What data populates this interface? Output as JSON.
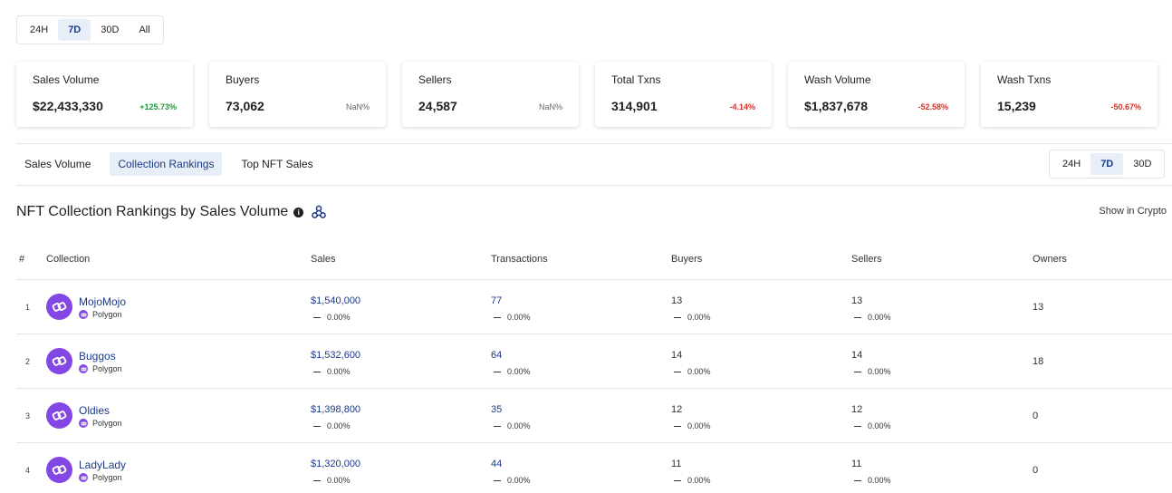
{
  "period_top": [
    "24H",
    "7D",
    "30D",
    "All"
  ],
  "period_top_active": 1,
  "stats": [
    {
      "label": "Sales Volume",
      "value": "$22,433,330",
      "change": "+125.73%",
      "trend": "pos"
    },
    {
      "label": "Buyers",
      "value": "73,062",
      "change": "NaN%",
      "trend": "neu"
    },
    {
      "label": "Sellers",
      "value": "24,587",
      "change": "NaN%",
      "trend": "neu"
    },
    {
      "label": "Total Txns",
      "value": "314,901",
      "change": "-4.14%",
      "trend": "neg"
    },
    {
      "label": "Wash Volume",
      "value": "$1,837,678",
      "change": "-52.58%",
      "trend": "neg"
    },
    {
      "label": "Wash Txns",
      "value": "15,239",
      "change": "-50.67%",
      "trend": "neg"
    }
  ],
  "tabs": [
    "Sales Volume",
    "Collection Rankings",
    "Top NFT Sales"
  ],
  "tabs_active": 1,
  "period_right": [
    "24H",
    "7D",
    "30D"
  ],
  "period_right_active": 1,
  "section": {
    "title": "NFT Collection Rankings by Sales Volume",
    "info_icon": "info-icon",
    "link_icon": "share-link-icon",
    "show_crypto": "Show in Crypto"
  },
  "columns": [
    "#",
    "Collection",
    "Sales",
    "Transactions",
    "Buyers",
    "Sellers",
    "Owners"
  ],
  "rows": [
    {
      "rank": "1",
      "name": "MojoMojo",
      "chain": "Polygon",
      "sales": "$1,540,000",
      "sales_chg": "0.00%",
      "txns": "77",
      "txns_chg": "0.00%",
      "buyers": "13",
      "buyers_chg": "0.00%",
      "sellers": "13",
      "sellers_chg": "0.00%",
      "owners": "13"
    },
    {
      "rank": "2",
      "name": "Buggos",
      "chain": "Polygon",
      "sales": "$1,532,600",
      "sales_chg": "0.00%",
      "txns": "64",
      "txns_chg": "0.00%",
      "buyers": "14",
      "buyers_chg": "0.00%",
      "sellers": "14",
      "sellers_chg": "0.00%",
      "owners": "18"
    },
    {
      "rank": "3",
      "name": "Oldies",
      "chain": "Polygon",
      "sales": "$1,398,800",
      "sales_chg": "0.00%",
      "txns": "35",
      "txns_chg": "0.00%",
      "buyers": "12",
      "buyers_chg": "0.00%",
      "sellers": "12",
      "sellers_chg": "0.00%",
      "owners": "0"
    },
    {
      "rank": "4",
      "name": "LadyLady",
      "chain": "Polygon",
      "sales": "$1,320,000",
      "sales_chg": "0.00%",
      "txns": "44",
      "txns_chg": "0.00%",
      "buyers": "11",
      "buyers_chg": "0.00%",
      "sellers": "11",
      "sellers_chg": "0.00%",
      "owners": "0"
    }
  ],
  "colors": {
    "accent": "#1a3a8a",
    "positive": "#1c9a3a",
    "negative": "#d93025",
    "polygon": "#8247e5"
  }
}
